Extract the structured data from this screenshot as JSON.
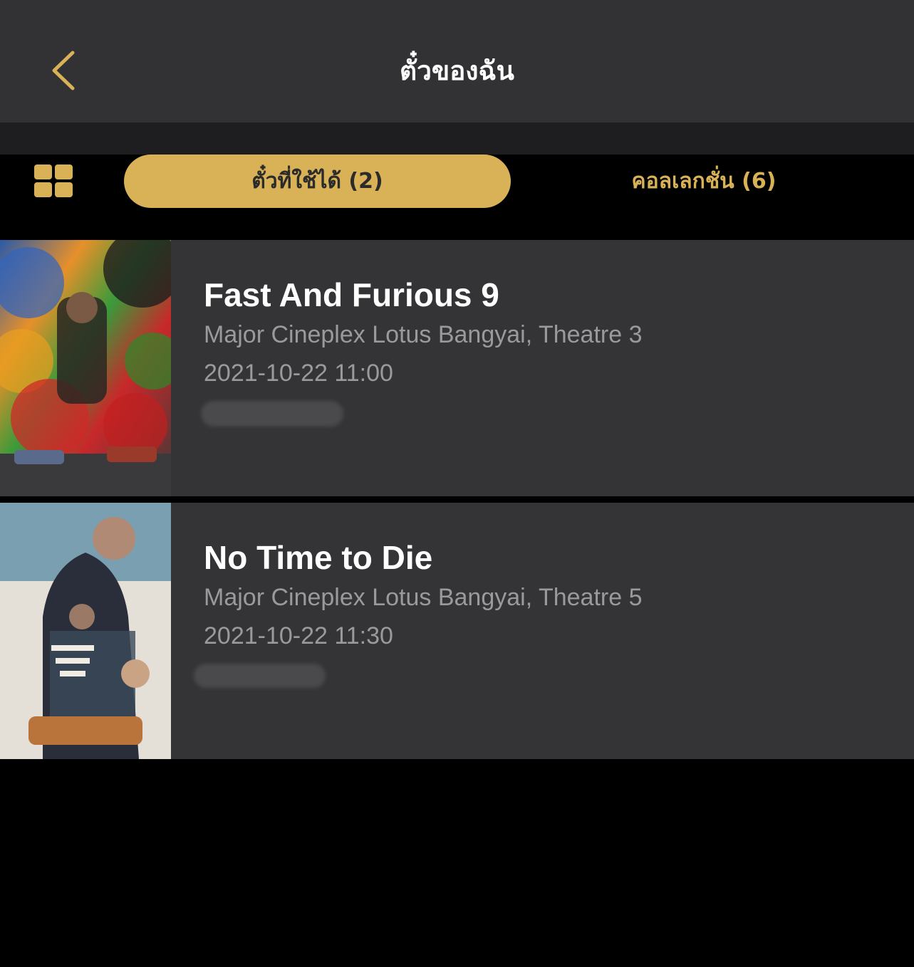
{
  "header": {
    "title": "ตั๋วของฉัน",
    "back_icon": "chevron-left-icon"
  },
  "tabs": {
    "grid_icon": "grid-icon",
    "active_label": "ตั๋วที่ใช้ได้ (2)",
    "inactive_label": "คอลเลกชั่น (6)"
  },
  "colors": {
    "accent": "#d9b257",
    "header_bg": "#323234",
    "card_bg": "#343436",
    "subtext": "#9a9a9c"
  },
  "tickets": [
    {
      "title": "Fast And Furious 9",
      "venue": "Major Cineplex Lotus Bangyai, Theatre 3",
      "datetime": "2021-10-22 11:00"
    },
    {
      "title": "No Time to Die",
      "venue": "Major Cineplex Lotus Bangyai, Theatre 5",
      "datetime": "2021-10-22 11:30"
    }
  ]
}
